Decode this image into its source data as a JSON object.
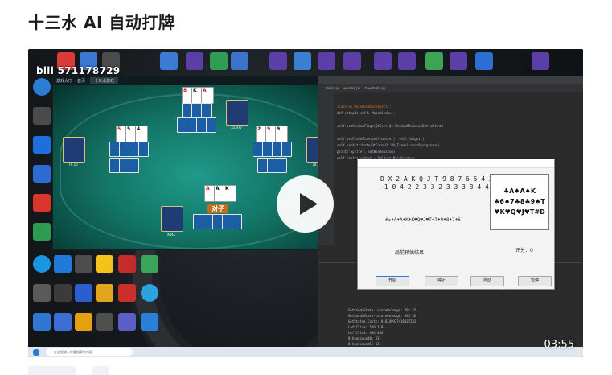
{
  "page": {
    "title": "十三水 AI 自动打牌"
  },
  "video": {
    "watermark": "bili 571178729",
    "duration": "03:55",
    "play_label": "play"
  },
  "game_window": {
    "tabs": [
      "游戏大厅",
      "首页",
      "十三水游戏"
    ],
    "center_player_name": "对子",
    "player_scores": [
      "32.977",
      "79.10",
      "30.11",
      "X443"
    ]
  },
  "ide": {
    "tabs": [
      "main.py",
      "window.py",
      "bluemate.py"
    ],
    "code_lines": [
      "class Ui_MainWindow(object):",
      "    def setupUi(self, MainWindow):",
      "        self.setWindowFlags(QtCore.Qt.WindowMinimizeButtonHint)",
      "        self.setFixedSize(self.width(), self.height())",
      "        self.setAttribute(QtCore.Qt.WA_TranslucentBackground)",
      "        print('Sprite', setWindowIcon)",
      "        self.centralwidget = QWidget(MainWindow)"
    ],
    "console_lines": [
      "GetCardsState-LocateOnImage: 791 52",
      "GetCardsState-LocateOnImage: 845 52",
      "GetStates Costs: 0.0149927418137232",
      "LeftClick: 519 110",
      "LeftClick: 494 464",
      "0 handcount0: 13",
      "0 handcount1: 13"
    ]
  },
  "dialog": {
    "line1": "D X 2 A K Q J T 9 8 7 6 5 4 3",
    "line2": "-1 0  4 2 2 3 3 2 3 3 3 3 4 4 4",
    "hand": "#◇♠A♠A♠K♠K♥Q♥J♥T♦T♦9♦8♠7♠6",
    "result_label": "局前预估结果：",
    "score_label": "评分：0",
    "box_lines": [
      "♣A♦A♠K",
      "♣6♠7♣8♣9♠T",
      "♥K♥Q♥J♥T#D"
    ],
    "buttons": [
      "开始",
      "停止",
      "自动",
      "暂停"
    ]
  },
  "taskbar": {
    "search_placeholder": "在这里输入你要搜索的内容"
  },
  "colors": {
    "table_green": "#137667",
    "ide_bg": "#2b2b2b",
    "accent_blue": "#3b7bd1"
  }
}
